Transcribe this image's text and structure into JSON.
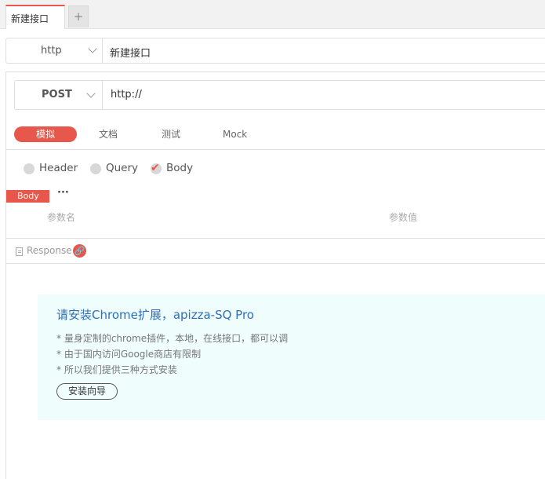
{
  "tabs": {
    "active_label": "新建接口",
    "add_label": "+"
  },
  "request": {
    "protocol": "http",
    "name_value": "新建接口",
    "method": "POST",
    "url_value": "http://"
  },
  "mode_tabs": [
    "模拟",
    "文档",
    "测试",
    "Mock"
  ],
  "param_types": {
    "header": "Header",
    "query": "Query",
    "body": "Body",
    "selected": "Body"
  },
  "body_section": {
    "badge": "Body",
    "more": "···"
  },
  "params_table": {
    "col_name": "参数名",
    "col_value": "参数值"
  },
  "response": {
    "label": "Response"
  },
  "notice": {
    "title": "请安装Chrome扩展，apizza-SQ Pro",
    "lines": [
      "* 量身定制的chrome插件，本地，在线接口，都可以调",
      "* 由于国内访问Google商店有限制",
      "* 所以我们提供三种方式安装"
    ],
    "button": "安装向导"
  },
  "colors": {
    "accent": "#e8574c",
    "notice_bg": "#effdfd",
    "notice_title": "#2f6fb5"
  },
  "icons": [
    "chevron-down-icon",
    "check-icon",
    "document-icon",
    "link-icon",
    "plus-icon"
  ]
}
